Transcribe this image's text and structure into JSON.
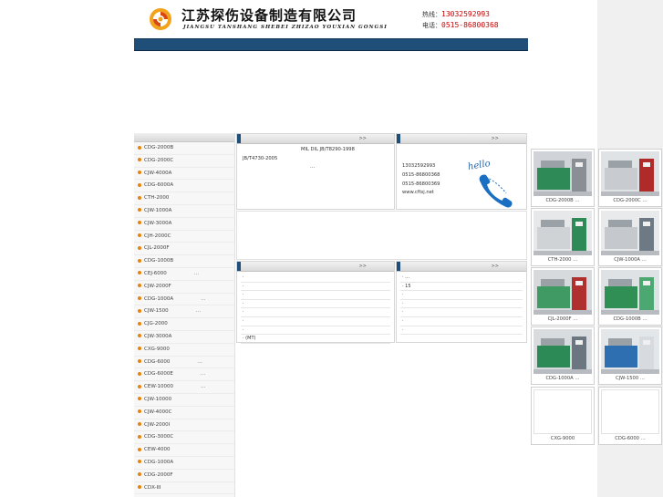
{
  "header": {
    "title_cn": "江苏探伤设备制造有限公司",
    "title_en": "JIANGSU TANSHANG SHEBEI ZHIZAO YOUXIAN GONGSI",
    "hotline_label": "热线：",
    "hotline": "13032592993",
    "phone_label": "电话：",
    "phone": "0515-86800368"
  },
  "product_list": [
    {
      "label": "CDG-2000B",
      "ext": ""
    },
    {
      "label": "CDG-2000C",
      "ext": ""
    },
    {
      "label": "CJW-4000A",
      "ext": ""
    },
    {
      "label": "CDG-6000A",
      "ext": ""
    },
    {
      "label": "CTH-2000",
      "ext": ""
    },
    {
      "label": "CJW-1000A",
      "ext": ""
    },
    {
      "label": "CJW-3000A",
      "ext": ""
    },
    {
      "label": "CJH-2000C",
      "ext": ""
    },
    {
      "label": "CJL-2000F",
      "ext": ""
    },
    {
      "label": "CDG-1000B",
      "ext": ""
    },
    {
      "label": "CEJ-6000",
      "ext": "…"
    },
    {
      "label": "CJW-2000F",
      "ext": ""
    },
    {
      "label": "CDG-1000A",
      "ext": "…"
    },
    {
      "label": "CJW-1500",
      "ext": "…"
    },
    {
      "label": "CJG-2000",
      "ext": ""
    },
    {
      "label": "CJW-3000A",
      "ext": ""
    },
    {
      "label": "CXG-9000",
      "ext": ""
    },
    {
      "label": "CDG-6000",
      "ext": "…"
    },
    {
      "label": "CDG-6000E",
      "ext": "…"
    },
    {
      "label": "CEW-10000",
      "ext": "…"
    },
    {
      "label": "CJW-10000",
      "ext": ""
    },
    {
      "label": "CJW-4000C",
      "ext": ""
    },
    {
      "label": "CJW-2000I",
      "ext": ""
    },
    {
      "label": "CDG-3000C",
      "ext": ""
    },
    {
      "label": "CEW-4000",
      "ext": ""
    },
    {
      "label": "CDG-1000A",
      "ext": ""
    },
    {
      "label": "CDG-2000F",
      "ext": ""
    },
    {
      "label": "CDX-III",
      "ext": ""
    }
  ],
  "about": {
    "more": ">>",
    "line1": "MIL   DIL          JB/T8290-1998",
    "line2": "JB/T4730-2005",
    "line3": "…"
  },
  "contact": {
    "more": ">>",
    "mobile": "13032592993",
    "tel": "0515-86800368",
    "fax": "0515-86800369",
    "web": "www.cftsj.net",
    "hello": "hello"
  },
  "news": {
    "more": ">>",
    "items": [
      "·",
      "·",
      "·",
      "·",
      "·",
      "·",
      "·",
      "·   (MT)"
    ]
  },
  "faq": {
    "more": ">>",
    "items": [
      "·            …",
      "·  15",
      "·",
      "·",
      "·",
      "·",
      "·"
    ]
  },
  "products": [
    {
      "caption": "CDG-2000B …",
      "icon": "machine-photo"
    },
    {
      "caption": "CDG-2000C …",
      "icon": "machine-photo"
    },
    {
      "caption": "CTH-2000 …",
      "icon": "machine-photo"
    },
    {
      "caption": "CJW-1000A …",
      "icon": "machine-photo"
    },
    {
      "caption": "CJL-2000F …",
      "icon": "machine-photo"
    },
    {
      "caption": "CDG-1000B …",
      "icon": "machine-photo"
    },
    {
      "caption": "CDG-1000A …",
      "icon": "machine-photo"
    },
    {
      "caption": "CJW-1500 …",
      "icon": "machine-photo"
    },
    {
      "caption": "CXG-9000",
      "icon": "empty"
    },
    {
      "caption": "CDG-6000 …",
      "icon": "empty"
    }
  ],
  "colors": {
    "nav": "#1f4e79",
    "accent": "#e8830c",
    "hotline": "#cc0000"
  }
}
